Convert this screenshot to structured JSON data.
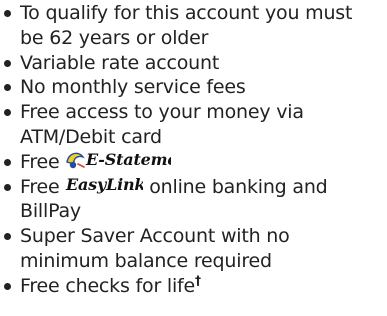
{
  "items": [
    {
      "line1": "To qualify for this account you must",
      "line2": "be 62 years or older"
    },
    {
      "line1": "Variable rate account"
    },
    {
      "line1": "No monthly service fees"
    },
    {
      "line1": "Free access to your money via",
      "line2": "ATM/Debit card"
    },
    {
      "prefix": "Free",
      "logo_text": "E-Statements"
    },
    {
      "prefix": "Free",
      "logo_text": "EasyLink",
      "suffix": "online banking and",
      "line2": "BillPay"
    },
    {
      "line1": "Super Saver Account with no",
      "line2": "minimum balance required"
    },
    {
      "line1": "Free checks for life",
      "dagger": "†"
    }
  ],
  "colors": {
    "text": "#222222",
    "logo_blue": "#1f4f9a",
    "logo_yellow": "#f3cb2b",
    "logo_text": "#111111"
  }
}
